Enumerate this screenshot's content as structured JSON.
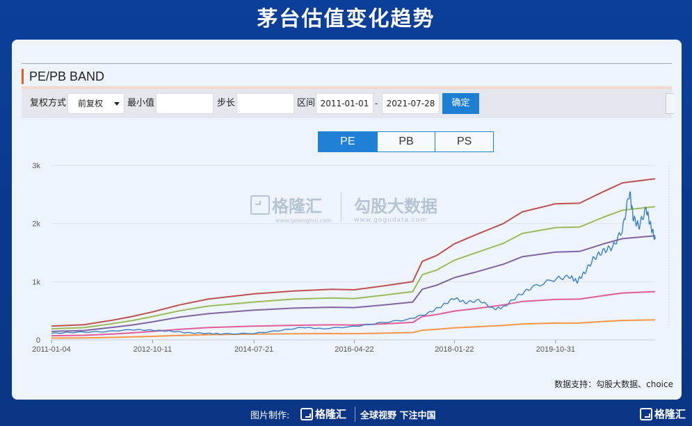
{
  "header": {
    "title": "茅台估值变化趋势"
  },
  "panel": {
    "title": "PE/PB BAND"
  },
  "toolbar": {
    "fq_label": "复权方式",
    "fq_value": "前复权",
    "min_label": "最小值",
    "min_value": "",
    "step_label": "步长",
    "step_value": "",
    "range_label": "区间",
    "start_date": "2011-01-01",
    "dash": "-",
    "end_date": "2021-07-28",
    "confirm_label": "确定"
  },
  "tabs": [
    {
      "label": "PE",
      "active": true
    },
    {
      "label": "PB",
      "active": false
    },
    {
      "label": "PS",
      "active": false
    }
  ],
  "watermark": {
    "brand1": "格隆汇",
    "brand1_url": "www.gelonghui.com",
    "brand2": "勾股大数据",
    "brand2_url": "www.gogudata.com"
  },
  "source": "数据支持：勾股大数据、choice",
  "footer": {
    "credit": "图片制作:",
    "brand": "格隆汇",
    "slogan": "全球视野 下注中国",
    "corner_brand": "格隆汇"
  },
  "chart_data": {
    "type": "line",
    "title": "",
    "xlabel": "",
    "ylabel": "",
    "x_range": [
      "2011-01-04",
      "2021-07-28"
    ],
    "ylim": [
      0,
      3000
    ],
    "y_ticks": [
      {
        "value": 0,
        "label": "0"
      },
      {
        "value": 1000,
        "label": "1k"
      },
      {
        "value": 2000,
        "label": "2k"
      },
      {
        "value": 3000,
        "label": "3k"
      }
    ],
    "x_ticks": [
      "2011-01-04",
      "2012-10-11",
      "2014-07-21",
      "2016-04-22",
      "2018-01-22",
      "2019-10-31"
    ],
    "grid": true,
    "series": [
      {
        "color": "#c0504d",
        "points": [
          [
            "2011-01-04",
            235
          ],
          [
            "2011-08-01",
            260
          ],
          [
            "2012-02-01",
            340
          ],
          [
            "2012-06-01",
            400
          ],
          [
            "2012-10-11",
            480
          ],
          [
            "2013-04-01",
            600
          ],
          [
            "2013-10-01",
            700
          ],
          [
            "2014-07-21",
            790
          ],
          [
            "2015-04-01",
            840
          ],
          [
            "2015-12-01",
            870
          ],
          [
            "2016-04-22",
            860
          ],
          [
            "2016-11-01",
            930
          ],
          [
            "2017-05-01",
            1000
          ],
          [
            "2017-07-01",
            1350
          ],
          [
            "2017-10-01",
            1450
          ],
          [
            "2018-01-22",
            1650
          ],
          [
            "2018-06-01",
            1800
          ],
          [
            "2018-12-01",
            2000
          ],
          [
            "2019-04-01",
            2200
          ],
          [
            "2019-10-31",
            2340
          ],
          [
            "2020-04-01",
            2350
          ],
          [
            "2020-09-01",
            2550
          ],
          [
            "2021-01-01",
            2700
          ],
          [
            "2021-07-28",
            2770
          ]
        ]
      },
      {
        "color": "#9bbb59",
        "points": [
          [
            "2011-01-04",
            190
          ],
          [
            "2011-08-01",
            210
          ],
          [
            "2012-02-01",
            280
          ],
          [
            "2012-06-01",
            330
          ],
          [
            "2012-10-11",
            400
          ],
          [
            "2013-04-01",
            500
          ],
          [
            "2013-10-01",
            580
          ],
          [
            "2014-07-21",
            650
          ],
          [
            "2015-04-01",
            700
          ],
          [
            "2015-12-01",
            720
          ],
          [
            "2016-04-22",
            710
          ],
          [
            "2016-11-01",
            770
          ],
          [
            "2017-05-01",
            830
          ],
          [
            "2017-07-01",
            1120
          ],
          [
            "2017-10-01",
            1200
          ],
          [
            "2018-01-22",
            1370
          ],
          [
            "2018-06-01",
            1490
          ],
          [
            "2018-12-01",
            1660
          ],
          [
            "2019-04-01",
            1830
          ],
          [
            "2019-10-31",
            1930
          ],
          [
            "2020-04-01",
            1940
          ],
          [
            "2020-09-01",
            2110
          ],
          [
            "2021-01-01",
            2230
          ],
          [
            "2021-07-28",
            2290
          ]
        ]
      },
      {
        "color": "#8064a2",
        "points": [
          [
            "2011-01-04",
            145
          ],
          [
            "2011-08-01",
            160
          ],
          [
            "2012-02-01",
            215
          ],
          [
            "2012-06-01",
            255
          ],
          [
            "2012-10-11",
            310
          ],
          [
            "2013-04-01",
            390
          ],
          [
            "2013-10-01",
            450
          ],
          [
            "2014-07-21",
            510
          ],
          [
            "2015-04-01",
            545
          ],
          [
            "2015-12-01",
            560
          ],
          [
            "2016-04-22",
            555
          ],
          [
            "2016-11-01",
            600
          ],
          [
            "2017-05-01",
            650
          ],
          [
            "2017-07-01",
            870
          ],
          [
            "2017-10-01",
            940
          ],
          [
            "2018-01-22",
            1070
          ],
          [
            "2018-06-01",
            1160
          ],
          [
            "2018-12-01",
            1300
          ],
          [
            "2019-04-01",
            1430
          ],
          [
            "2019-10-31",
            1510
          ],
          [
            "2020-04-01",
            1520
          ],
          [
            "2020-09-01",
            1650
          ],
          [
            "2021-01-01",
            1740
          ],
          [
            "2021-07-28",
            1790
          ]
        ]
      },
      {
        "color": "#e05c9a",
        "points": [
          [
            "2011-01-04",
            70
          ],
          [
            "2011-08-01",
            78
          ],
          [
            "2012-02-01",
            100
          ],
          [
            "2012-06-01",
            120
          ],
          [
            "2012-10-11",
            145
          ],
          [
            "2013-04-01",
            180
          ],
          [
            "2013-10-01",
            210
          ],
          [
            "2014-07-21",
            235
          ],
          [
            "2015-04-01",
            250
          ],
          [
            "2015-12-01",
            258
          ],
          [
            "2016-04-22",
            255
          ],
          [
            "2016-11-01",
            275
          ],
          [
            "2017-05-01",
            300
          ],
          [
            "2017-07-01",
            400
          ],
          [
            "2017-10-01",
            435
          ],
          [
            "2018-01-22",
            495
          ],
          [
            "2018-06-01",
            535
          ],
          [
            "2018-12-01",
            600
          ],
          [
            "2019-04-01",
            660
          ],
          [
            "2019-10-31",
            695
          ],
          [
            "2020-04-01",
            700
          ],
          [
            "2020-09-01",
            760
          ],
          [
            "2021-01-01",
            805
          ],
          [
            "2021-07-28",
            830
          ]
        ]
      },
      {
        "color": "#f79646",
        "points": [
          [
            "2011-01-04",
            30
          ],
          [
            "2011-08-01",
            33
          ],
          [
            "2012-02-01",
            42
          ],
          [
            "2012-06-01",
            50
          ],
          [
            "2012-10-11",
            60
          ],
          [
            "2013-04-01",
            75
          ],
          [
            "2013-10-01",
            88
          ],
          [
            "2014-07-21",
            98
          ],
          [
            "2015-04-01",
            104
          ],
          [
            "2015-12-01",
            108
          ],
          [
            "2016-04-22",
            106
          ],
          [
            "2016-11-01",
            115
          ],
          [
            "2017-05-01",
            125
          ],
          [
            "2017-07-01",
            165
          ],
          [
            "2017-10-01",
            180
          ],
          [
            "2018-01-22",
            205
          ],
          [
            "2018-06-01",
            222
          ],
          [
            "2018-12-01",
            248
          ],
          [
            "2019-04-01",
            272
          ],
          [
            "2019-10-31",
            288
          ],
          [
            "2020-04-01",
            290
          ],
          [
            "2020-09-01",
            315
          ],
          [
            "2021-01-01",
            333
          ],
          [
            "2021-07-28",
            343
          ]
        ]
      },
      {
        "color": "#3a7fc1",
        "points": [
          [
            "2011-01-04",
            110
          ],
          [
            "2011-06-01",
            130
          ],
          [
            "2011-12-01",
            140
          ],
          [
            "2012-06-01",
            175
          ],
          [
            "2012-10-11",
            165
          ],
          [
            "2013-02-01",
            150
          ],
          [
            "2013-06-01",
            120
          ],
          [
            "2013-10-01",
            110
          ],
          [
            "2014-01-01",
            100
          ],
          [
            "2014-07-21",
            110
          ],
          [
            "2015-01-01",
            160
          ],
          [
            "2015-06-01",
            215
          ],
          [
            "2015-10-01",
            190
          ],
          [
            "2016-04-22",
            230
          ],
          [
            "2016-10-01",
            290
          ],
          [
            "2017-04-01",
            350
          ],
          [
            "2017-08-01",
            450
          ],
          [
            "2017-11-01",
            580
          ],
          [
            "2018-01-22",
            720
          ],
          [
            "2018-04-01",
            640
          ],
          [
            "2018-07-01",
            680
          ],
          [
            "2018-10-01",
            530
          ],
          [
            "2018-12-01",
            560
          ],
          [
            "2019-03-01",
            750
          ],
          [
            "2019-06-01",
            900
          ],
          [
            "2019-10-31",
            1050
          ],
          [
            "2020-02-01",
            1090
          ],
          [
            "2020-03-15",
            1000
          ],
          [
            "2020-05-01",
            1150
          ],
          [
            "2020-07-01",
            1400
          ],
          [
            "2020-09-01",
            1530
          ],
          [
            "2020-11-01",
            1600
          ],
          [
            "2021-01-01",
            1900
          ],
          [
            "2021-02-15",
            2560
          ],
          [
            "2021-03-10",
            2100
          ],
          [
            "2021-04-15",
            1950
          ],
          [
            "2021-06-01",
            2250
          ],
          [
            "2021-07-01",
            1950
          ],
          [
            "2021-07-28",
            1730
          ]
        ]
      }
    ]
  }
}
